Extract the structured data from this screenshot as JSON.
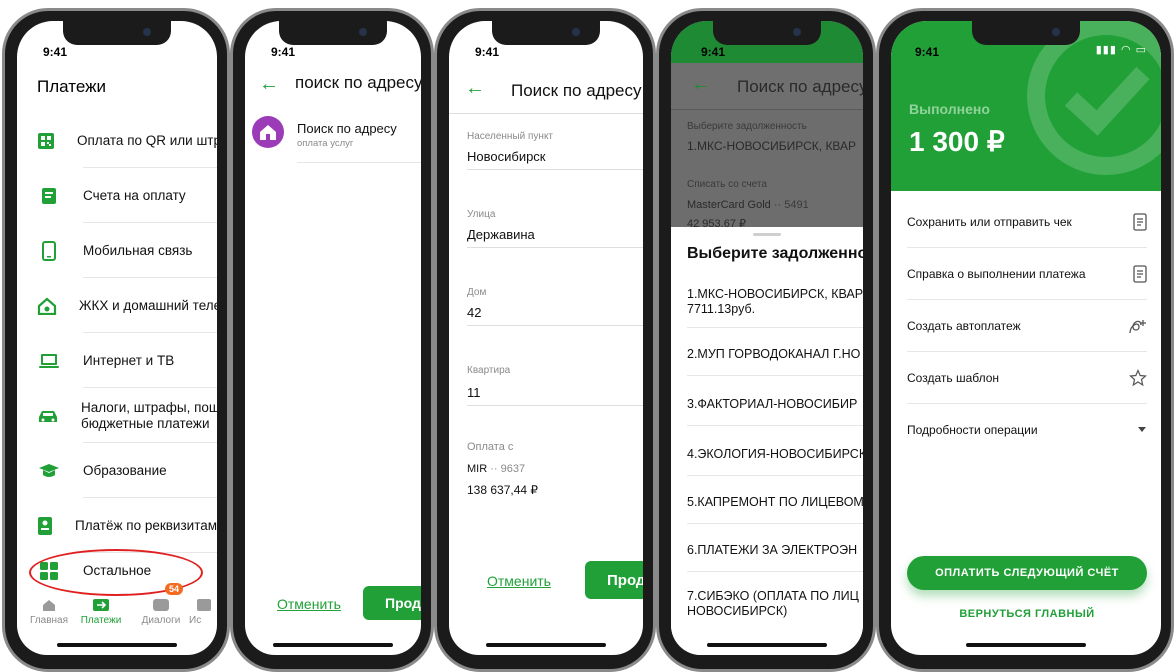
{
  "time": "9:41",
  "screen1": {
    "title": "Платежи",
    "items": [
      {
        "icon": "qr-code-icon",
        "label": "Оплата по QR или штри"
      },
      {
        "icon": "invoice-icon",
        "label": "Счета на оплату"
      },
      {
        "icon": "mobile-phone-icon",
        "label": "Мобильная связь"
      },
      {
        "icon": "house-phone-icon",
        "label": "ЖКХ и домашний телес"
      },
      {
        "icon": "laptop-icon",
        "label": "Интернет и ТВ"
      },
      {
        "icon": "car-icon",
        "label": "Налоги, штрафы, пошл",
        "label2": "бюджетные платежи"
      },
      {
        "icon": "graduation-cap-icon",
        "label": "Образование"
      },
      {
        "icon": "requisites-icon",
        "label": "Платёж по реквизитам"
      },
      {
        "icon": "grid-icon",
        "label": "Остальное"
      }
    ],
    "tabs": [
      {
        "label": "Главная",
        "icon": "home-icon"
      },
      {
        "label": "Платежи",
        "icon": "transfer-icon",
        "active": true
      },
      {
        "label": "Диалоги",
        "icon": "chat-icon",
        "badge": "54"
      },
      {
        "label": "Ис",
        "icon": "history-icon"
      }
    ]
  },
  "screen2": {
    "title": "поиск по адресу",
    "result_title": "Поиск по адресу",
    "result_subtitle": "оплата услуг",
    "cancel_label": "Отменить",
    "continue_label": "Продол"
  },
  "screen3": {
    "title": "Поиск по адресу",
    "fields": [
      {
        "label": "Населенный пункт",
        "value": "Новосибирск"
      },
      {
        "label": "Улица",
        "value": "Державина"
      },
      {
        "label": "Дом",
        "value": "42"
      },
      {
        "label": "Квартира",
        "value": "11"
      }
    ],
    "pay_from_label": "Оплата с",
    "card_name": "MIR",
    "card_mask": "·· 9637",
    "balance": "138 637,44 ₽",
    "cancel_label": "Отменить",
    "continue_label": "Продол"
  },
  "screen4": {
    "title": "Поиск по адресу",
    "debt_label": "Выберите задолженность",
    "debt_value": "1.МКС-НОВОСИБИРСК, КВАР",
    "account_label": "Списать со счета",
    "account_name": "MasterCard Gold",
    "account_mask": "·· 5491",
    "account_balance": "42 953,67 ₽",
    "sheet_title": "Выберите задолженно",
    "options": [
      {
        "line1": "1.МКС-НОВОСИБИРСК, КВАР",
        "line2": "7711.13руб."
      },
      {
        "line1": "2.МУП ГОРВОДОКАНАЛ Г.НО"
      },
      {
        "line1": "3.ФАКТОРИАЛ-НОВОСИБИР"
      },
      {
        "line1": "4.ЭКОЛОГИЯ-НОВОСИБИРСК"
      },
      {
        "line1": "5.КАПРЕМОНТ ПО ЛИЦЕВОМ"
      },
      {
        "line1": "6.ПЛАТЕЖИ ЗА ЭЛЕКТРОЭН"
      },
      {
        "line1": "7.СИБЭКО (ОПЛАТА ПО ЛИЦ",
        "line2": "НОВОСИБИРСК)"
      }
    ]
  },
  "screen5": {
    "status": "Выполнено",
    "amount": "1 300 ₽",
    "actions": [
      {
        "label": "Сохранить или отправить чек",
        "icon": "receipt-icon"
      },
      {
        "label": "Справка о выполнении платежа",
        "icon": "document-icon"
      },
      {
        "label": "Создать автоплатеж",
        "icon": "autopay-icon"
      },
      {
        "label": "Создать шаблон",
        "icon": "star-icon"
      },
      {
        "label": "Подробности операции",
        "icon": "chevron-down-icon"
      }
    ],
    "pay_next_label": "ОПЛАТИТЬ СЛЕДУЮЩИЙ СЧЁТ",
    "back_main_label": "ВЕРНУТЬСЯ ГЛАВНЫЙ"
  },
  "colors": {
    "accent": "#21a038",
    "badge": "#f26b21",
    "highlight": "#e02020"
  }
}
